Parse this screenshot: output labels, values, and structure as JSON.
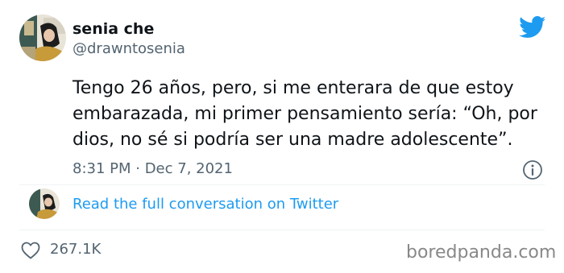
{
  "user": {
    "name": "senia che",
    "handle": "@drawntosenia"
  },
  "tweet": {
    "lines": [
      "Tengo 26 años, pero, si me enterara de que estoy",
      "embarazada, mi primer pensamiento sería: “Oh, por",
      "dios, no sé si podría ser una madre adolescente”."
    ],
    "timestamp": "8:31 PM · Dec 7, 2021"
  },
  "conversation_link": "Read the full conversation on Twitter",
  "likes": "267.1K",
  "watermark": "boredpanda.com",
  "colors": {
    "twitter_blue": "#1d9bf0",
    "secondary_text": "#536471",
    "primary_text": "#0f1419"
  },
  "icons": [
    "twitter-bird-icon",
    "info-icon",
    "heart-icon"
  ]
}
